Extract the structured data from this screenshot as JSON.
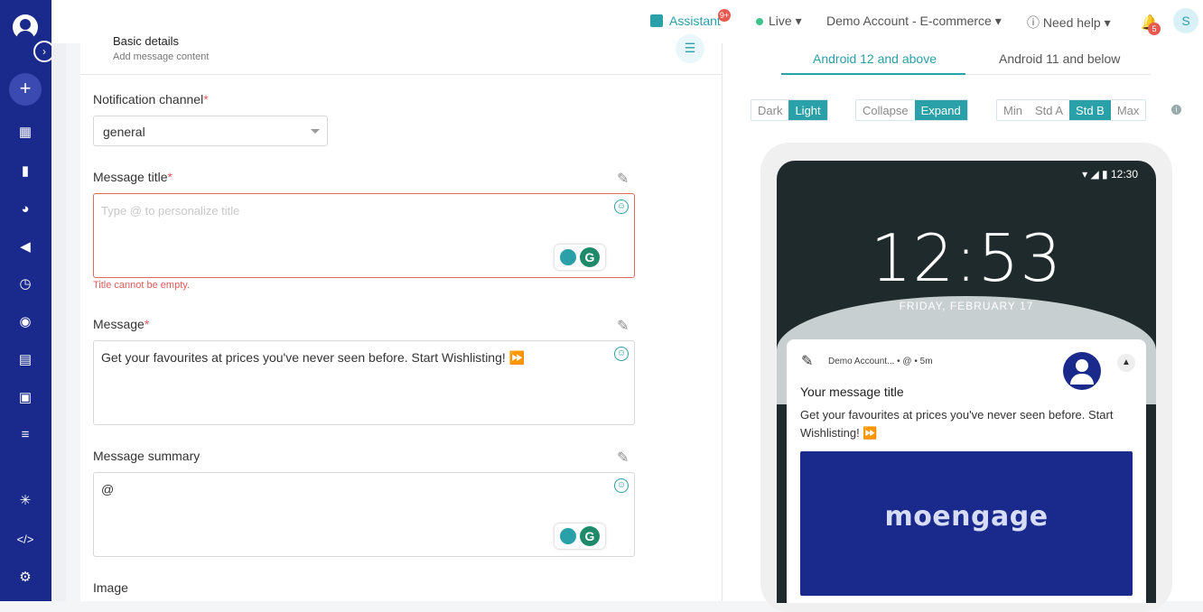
{
  "topbar": {
    "assistant_label": "Assistant",
    "assistant_badge": "9+",
    "live_label": "Live",
    "account_label": "Demo Account - E-commerce",
    "help_label": "Need help",
    "notifications_badge": "5",
    "avatar_letter": "S"
  },
  "section": {
    "title": "Basic details",
    "subtitle": "Add message content"
  },
  "form": {
    "channel_label": "Notification channel",
    "channel_value": "general",
    "title_label": "Message title",
    "title_placeholder": "Type @ to personalize title",
    "title_error": "Title cannot be empty.",
    "message_label": "Message",
    "message_value": "Get your favourites at prices you've never seen before. Start Wishlisting! ⏩",
    "summary_label": "Message summary",
    "summary_value": "@",
    "image_label": "Image",
    "required_mark": "*"
  },
  "preview": {
    "tabs": [
      "Android 12 and above",
      "Android 11 and below"
    ],
    "active_tab": 0,
    "theme_options": [
      "Dark",
      "Light"
    ],
    "theme_selected": "Light",
    "view_options": [
      "Collapse",
      "Expand"
    ],
    "view_selected": "Expand",
    "size_options": [
      "Min",
      "Std A",
      "Std B",
      "Max"
    ],
    "size_selected": "Std B",
    "status_time": "12:30",
    "clock": "12:53",
    "date": "FRIDAY, FEBRUARY 17",
    "notif_meta": "Demo Account... • @ • 5m",
    "notif_title": "Your message title",
    "notif_body": "Get your favourites at prices you've never seen before. Start Wishlisting! ⏩",
    "brand": "moengage"
  },
  "colors": {
    "sidebar": "#1a2a8c",
    "accent": "#2aa0a8",
    "error": "#e05a5a"
  }
}
